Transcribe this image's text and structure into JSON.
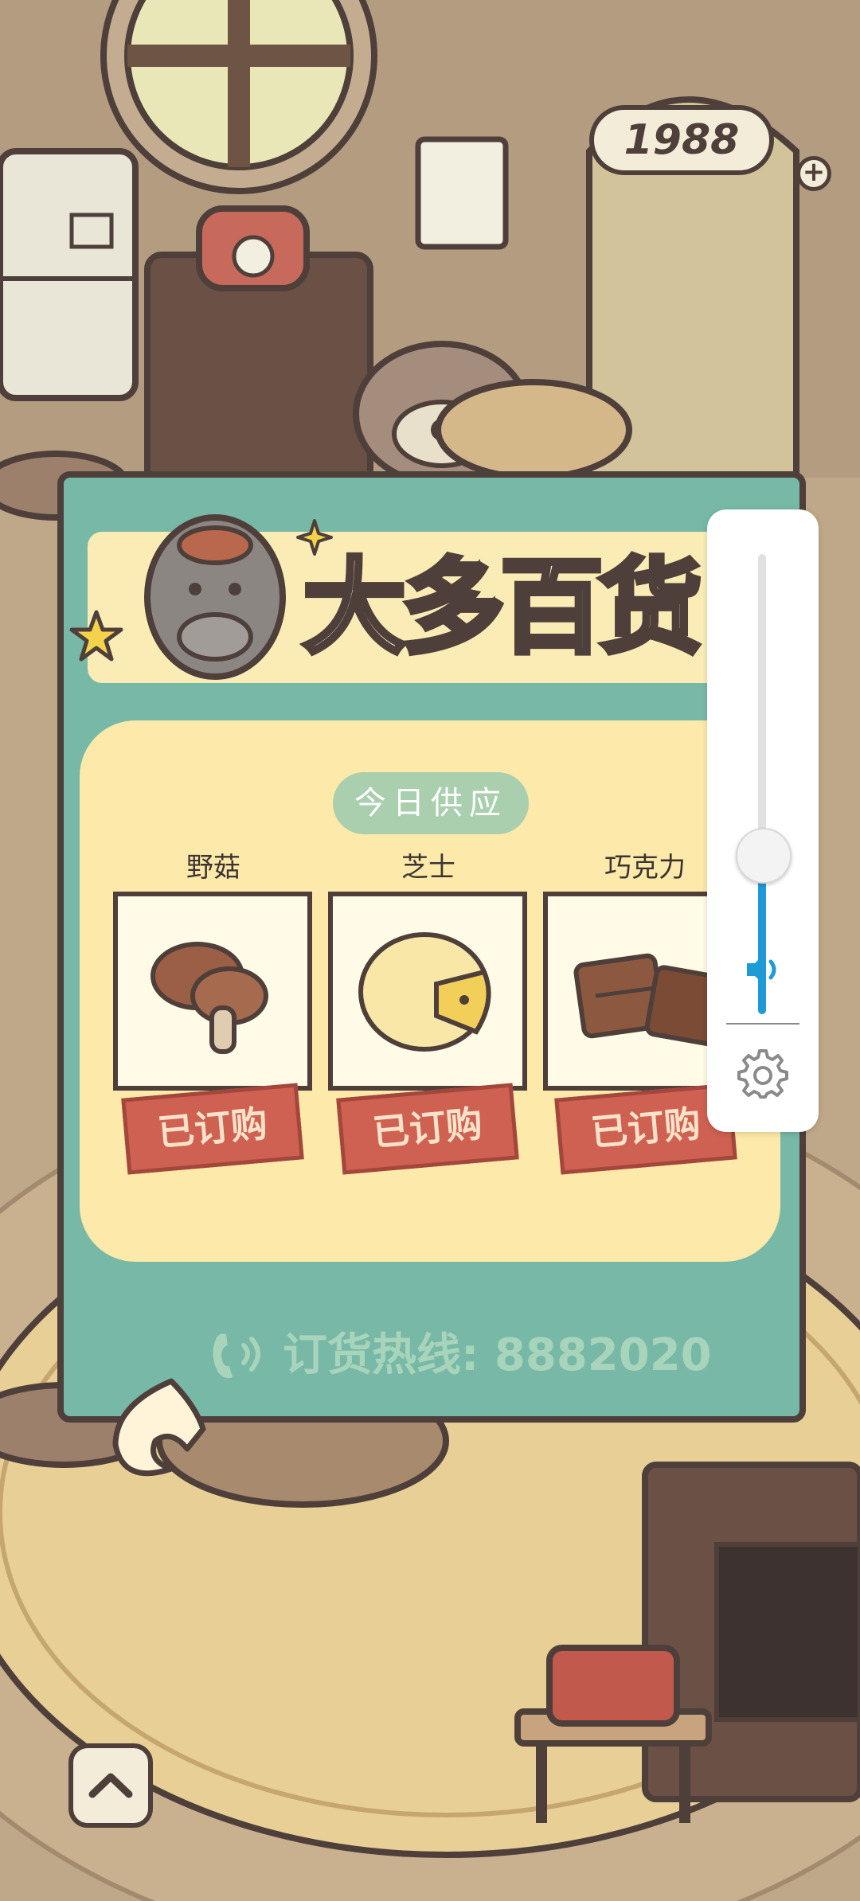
{
  "currency": {
    "amount": "1988"
  },
  "shop": {
    "title": "大多百货",
    "section_label": "今日供应",
    "items": [
      {
        "name": "野菇",
        "status": "已订购",
        "icon": "mushroom-icon"
      },
      {
        "name": "芝士",
        "status": "已订购",
        "icon": "cheese-icon"
      },
      {
        "name": "巧克力",
        "status": "已订购",
        "icon": "chocolate-icon"
      }
    ],
    "hotline": "订货热线: 8882020"
  },
  "volume": {
    "level": 0.45,
    "accent": "#1e9bd6"
  },
  "colors": {
    "panel": "#77b9a6",
    "banner": "#fbecb6",
    "stamp": "#cf6152",
    "outline": "#4e3f3a"
  }
}
